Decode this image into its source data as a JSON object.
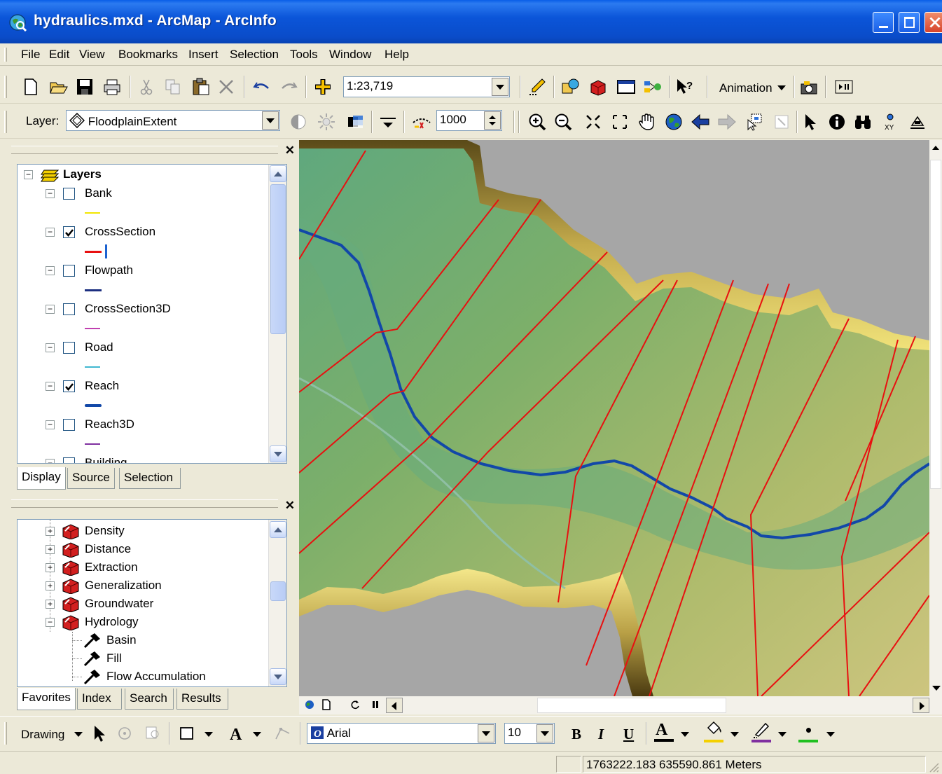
{
  "window": {
    "title": "hydraulics.mxd - ArcMap - ArcInfo"
  },
  "menu": [
    "File",
    "Edit",
    "View",
    "Bookmarks",
    "Insert",
    "Selection",
    "Tools",
    "Window",
    "Help"
  ],
  "standard_toolbar": {
    "scale": "1:23,719",
    "animation_label": "Animation"
  },
  "effects_toolbar": {
    "layer_label": "Layer:",
    "layer_value": "FloodplainExtent",
    "offset_value": "1000"
  },
  "toc": {
    "root": "Layers",
    "layers": [
      {
        "name": "Bank",
        "checked": false,
        "color": "#f2e600"
      },
      {
        "name": "CrossSection",
        "checked": true,
        "color": "#e81010"
      },
      {
        "name": "Flowpath",
        "checked": false,
        "color": "#1c2f80"
      },
      {
        "name": "CrossSection3D",
        "checked": false,
        "color": "#c040b0"
      },
      {
        "name": "Road",
        "checked": false,
        "color": "#40b8d0"
      },
      {
        "name": "Reach",
        "checked": true,
        "color": "#1248a8"
      },
      {
        "name": "Reach3D",
        "checked": false,
        "color": "#8030a0"
      },
      {
        "name": "Building",
        "checked": false,
        "color": "#000000"
      }
    ],
    "tabs": [
      "Display",
      "Source",
      "Selection"
    ]
  },
  "toolbox": {
    "toolsets": [
      "Density",
      "Distance",
      "Extraction",
      "Generalization",
      "Groundwater",
      "Hydrology"
    ],
    "hydrology_tools": [
      "Basin",
      "Fill",
      "Flow Accumulation"
    ],
    "tabs": [
      "Favorites",
      "Index",
      "Search",
      "Results"
    ]
  },
  "drawing_toolbar": {
    "drawing_label": "Drawing",
    "font": "Arial",
    "font_size": "10",
    "bold": "B",
    "italic": "I",
    "underline": "U",
    "font_color_glyph": "A"
  },
  "status": {
    "coordinates": "1763222.183  635590.861 Meters"
  },
  "colors": {
    "title_blue": "#0a4cc9",
    "cross_section": "#e81010",
    "reach": "#1248a8"
  }
}
